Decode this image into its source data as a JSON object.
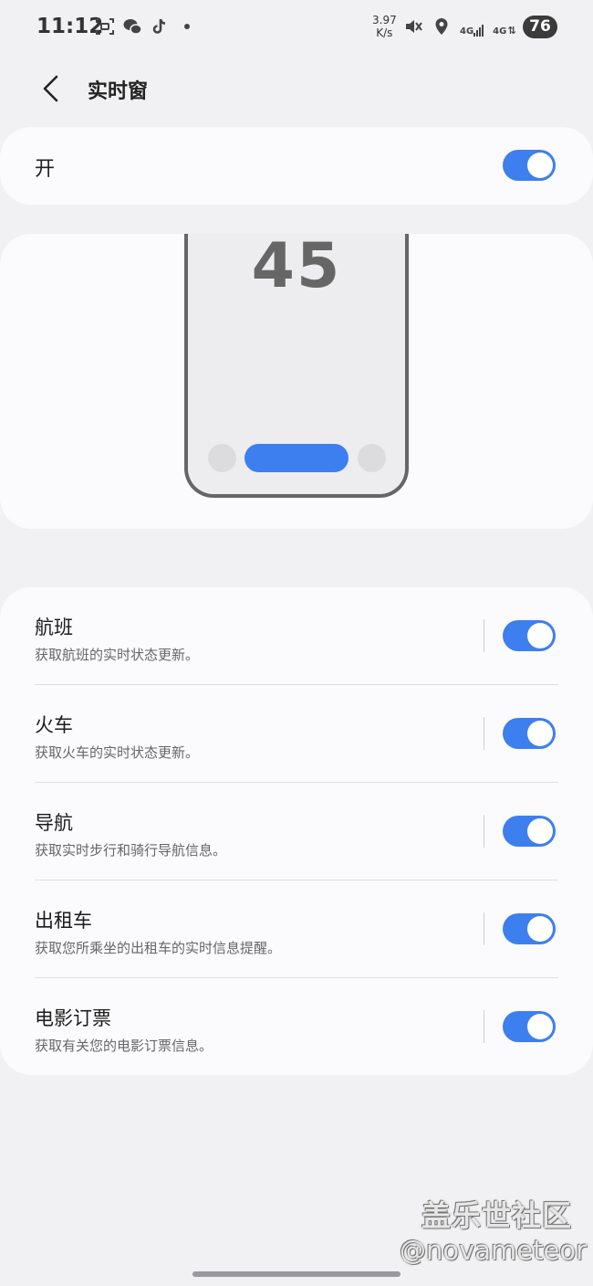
{
  "status_bar": {
    "time": "11:12",
    "net_speed_value": "3.97",
    "net_speed_unit": "K/s",
    "network_1": "4G",
    "network_2": "4G",
    "battery": "76",
    "icons": [
      "screenshot-icon",
      "wechat-icon",
      "tiktok-icon",
      "mute-icon",
      "location-icon",
      "signal-icon"
    ]
  },
  "header": {
    "title": "实时窗"
  },
  "master_toggle": {
    "label": "开",
    "on": true
  },
  "preview": {
    "number": "45"
  },
  "items": [
    {
      "title": "航班",
      "subtitle": "获取航班的实时状态更新。",
      "on": true
    },
    {
      "title": "火车",
      "subtitle": "获取火车的实时状态更新。",
      "on": true
    },
    {
      "title": "导航",
      "subtitle": "获取实时步行和骑行导航信息。",
      "on": true
    },
    {
      "title": "出租车",
      "subtitle": "获取您所乘坐的出租车的实时信息提醒。",
      "on": true
    },
    {
      "title": "电影订票",
      "subtitle": "获取有关您的电影订票信息。",
      "on": true
    }
  ],
  "watermark": {
    "line1": "盖乐世社区",
    "line2": "@novameteor"
  },
  "colors": {
    "accent": "#3d7fee",
    "background": "#f1f1f3",
    "card": "#fbfbfd"
  }
}
